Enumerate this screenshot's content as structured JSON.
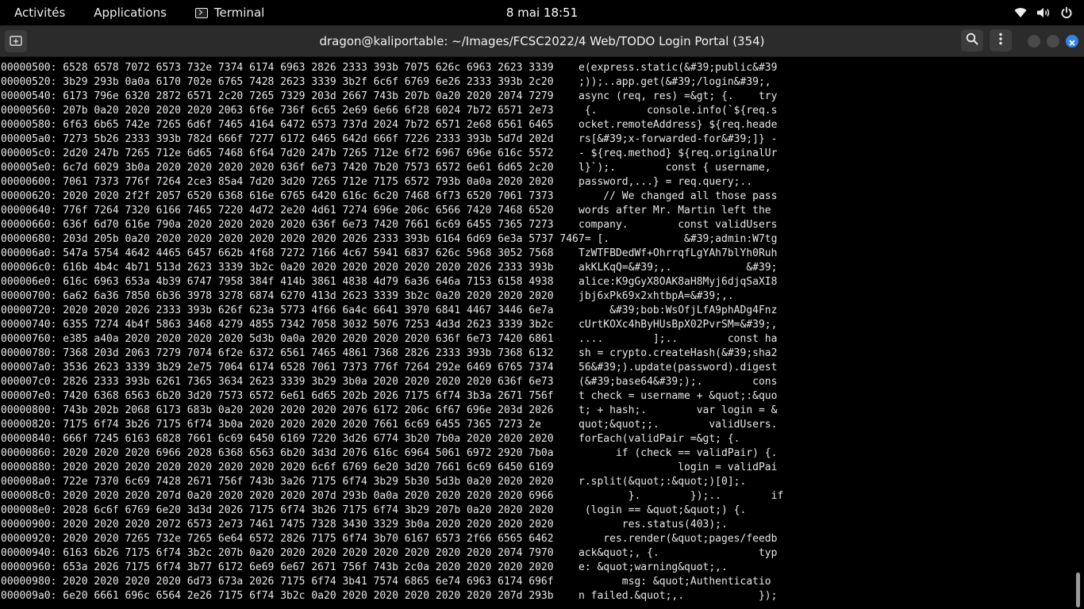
{
  "topbar": {
    "activities": "Activités",
    "applications": "Applications",
    "terminal_label": "Terminal",
    "clock": "8 mai  18:51"
  },
  "window": {
    "title": "dragon@kaliportable: ~/Images/FCSC2022/4 Web/TODO Login Portal (354)"
  },
  "hexdump": {
    "lines": [
      "00000500: 6528 6578 7072 6573 732e 7374 6174 6963 2826 2333 393b 7075 626c 6963 2623 3339",
      "00000520: 3b29 293b 0a0a 6170 702e 6765 7428 2623 3339 3b2f 6c6f 6769 6e26 2333 393b 2c20",
      "00000540: 6173 796e 6320 2872 6571 2c20 7265 7329 203d 2667 743b 207b 0a20 2020 2074 7279",
      "00000560: 207b 0a20 2020 2020 2020 2063 6f6e 736f 6c65 2e69 6e66 6f28 6024 7b72 6571 2e73",
      "00000580: 6f63 6b65 742e 7265 6d6f 7465 4164 6472 6573 737d 2024 7b72 6571 2e68 6561 6465",
      "000005a0: 7273 5b26 2333 393b 782d 666f 7277 6172 6465 642d 666f 7226 2333 393b 5d7d 202d",
      "000005c0: 2d20 247b 7265 712e 6d65 7468 6f64 7d20 247b 7265 712e 6f72 6967 696e 616c 5572",
      "000005e0: 6c7d 6029 3b0a 2020 2020 2020 2020 636f 6e73 7420 7b20 7573 6572 6e61 6d65 2c20",
      "00000600: 7061 7373 776f 7264 2ce3 85a4 7d20 3d20 7265 712e 7175 6572 793b 0a0a 2020 2020",
      "00000620: 2020 2020 2f2f 2057 6520 6368 616e 6765 6420 616c 6c20 7468 6f73 6520 7061 7373",
      "00000640: 776f 7264 7320 6166 7465 7220 4d72 2e20 4d61 7274 696e 206c 6566 7420 7468 6520",
      "00000660: 636f 6d70 616e 790a 2020 2020 2020 2020 636f 6e73 7420 7661 6c69 6455 7365 7273",
      "00000680: 203d 205b 0a20 2020 2020 2020 2020 2020 2020 2026 2333 393b 6164 6d69 6e3a 5737 7467",
      "000006a0: 547a 5754 4642 4465 6457 662b 4f68 7272 7166 4c67 5941 6837 626c 5968 3052 7568",
      "000006c0: 616b 4b4c 4b71 513d 2623 3339 3b2c 0a20 2020 2020 2020 2020 2020 2026 2333 393b",
      "000006e0: 616c 6963 653a 4b39 6747 7958 384f 414b 3861 4838 4d79 6a36 646a 7153 6158 4938",
      "00000700: 6a62 6a36 7850 6b36 3978 3278 6874 6270 413d 2623 3339 3b2c 0a20 2020 2020 2020",
      "00000720: 2020 2020 2026 2333 393b 626f 623a 5773 4f66 6a4c 6641 3970 6841 4467 3446 6e7a",
      "00000740: 6355 7274 4b4f 5863 3468 4279 4855 7342 7058 3032 5076 7253 4d3d 2623 3339 3b2c",
      "00000760: e385 a40a 2020 2020 2020 2020 5d3b 0a0a 2020 2020 2020 2020 636f 6e73 7420 6861",
      "00000780: 7368 203d 2063 7279 7074 6f2e 6372 6561 7465 4861 7368 2826 2333 393b 7368 6132",
      "000007a0: 3536 2623 3339 3b29 2e75 7064 6174 6528 7061 7373 776f 7264 292e 6469 6765 7374",
      "000007c0: 2826 2333 393b 6261 7365 3634 2623 3339 3b29 3b0a 2020 2020 2020 2020 636f 6e73",
      "000007e0: 7420 6368 6563 6b20 3d20 7573 6572 6e61 6d65 202b 2026 7175 6f74 3b3a 2671 756f",
      "00000800: 743b 202b 2068 6173 683b 0a20 2020 2020 2020 2076 6172 206c 6f67 696e 203d 2026",
      "00000820: 7175 6f74 3b26 7175 6f74 3b0a 2020 2020 2020 2020 7661 6c69 6455 7365 7273 2e",
      "00000840: 666f 7245 6163 6828 7661 6c69 6450 6169 7220 3d26 6774 3b20 7b0a 2020 2020 2020",
      "00000860: 2020 2020 2020 6966 2028 6368 6563 6b20 3d3d 2076 616c 6964 5061 6972 2920 7b0a",
      "00000880: 2020 2020 2020 2020 2020 2020 2020 2020 6c6f 6769 6e20 3d20 7661 6c69 6450 6169",
      "000008a0: 722e 7370 6c69 7428 2671 756f 743b 3a26 7175 6f74 3b29 5b30 5d3b 0a20 2020 2020",
      "000008c0: 2020 2020 2020 207d 0a20 2020 2020 2020 207d 293b 0a0a 2020 2020 2020 2020 6966",
      "000008e0: 2028 6c6f 6769 6e20 3d3d 2026 7175 6f74 3b26 7175 6f74 3b29 207b 0a20 2020 2020",
      "00000900: 2020 2020 2020 2072 6573 2e73 7461 7475 7328 3430 3329 3b0a 2020 2020 2020 2020",
      "00000920: 2020 2020 7265 732e 7265 6e64 6572 2826 7175 6f74 3b70 6167 6573 2f66 6565 6462",
      "00000940: 6163 6b26 7175 6f74 3b2c 207b 0a20 2020 2020 2020 2020 2020 2020 2020 2074 7970",
      "00000960: 653a 2026 7175 6f74 3b77 6172 6e69 6e67 2671 756f 743b 2c0a 2020 2020 2020 2020",
      "00000980: 2020 2020 2020 2020 6d73 673a 2026 7175 6f74 3b41 7574 6865 6e74 6963 6174 696f",
      "000009a0: 6e20 6661 696c 6564 2e26 7175 6f74 3b2c 0a20 2020 2020 2020 2020 2020 207d 293b"
    ],
    "ascii": [
      "e(express.static(&#39;public&#39",
      ";));..app.get(&#39;/login&#39;,",
      "async (req, res) =&gt; {.    try",
      " {.        console.info(`${req.s",
      "ocket.remoteAddress} ${req.heade",
      "rs[&#39;x-forwarded-for&#39;]} -",
      "- ${req.method} ${req.originalUr",
      "l}`);.        const { username,",
      "password,...} = req.query;..",
      "    // We changed all those pass",
      "words after Mr. Martin left the",
      "company.        const validUsers",
      " = [.            &#39;admin:W7tg",
      "TzWTFBDedWf+OhrrqfLgYAh7blYh0Ruh",
      "akKLKqQ=&#39;,.            &#39;",
      "alice:K9gGyX8OAK8aH8Myj6djqSaXI8",
      "jbj6xPk69x2xhtbpA=&#39;,.",
      "     &#39;bob:WsOfjLfA9phADg4Fnz",
      "cUrtKOXc4hByHUsBpX02PvrSM=&#39;,",
      "....        ];..        const ha",
      "sh = crypto.createHash(&#39;sha2",
      "56&#39;).update(password).digest",
      "(&#39;base64&#39;);.        cons",
      "t check = username + &quot;:&quo",
      "t; + hash;.        var login = &",
      "quot;&quot;;.        validUsers.",
      "forEach(validPair =&gt; {.",
      "      if (check == validPair) {.",
      "                login = validPai",
      "r.split(&quot;:&quot;)[0];.",
      "        }.        });..        if",
      " (login == &quot;&quot;) {.",
      "       res.status(403);.",
      "    res.render(&quot;pages/feedb",
      "ack&quot;, {.                typ",
      "e: &quot;warning&quot;,.",
      "       msg: &quot;Authenticatio",
      "n failed.&quot;,.            });"
    ]
  }
}
